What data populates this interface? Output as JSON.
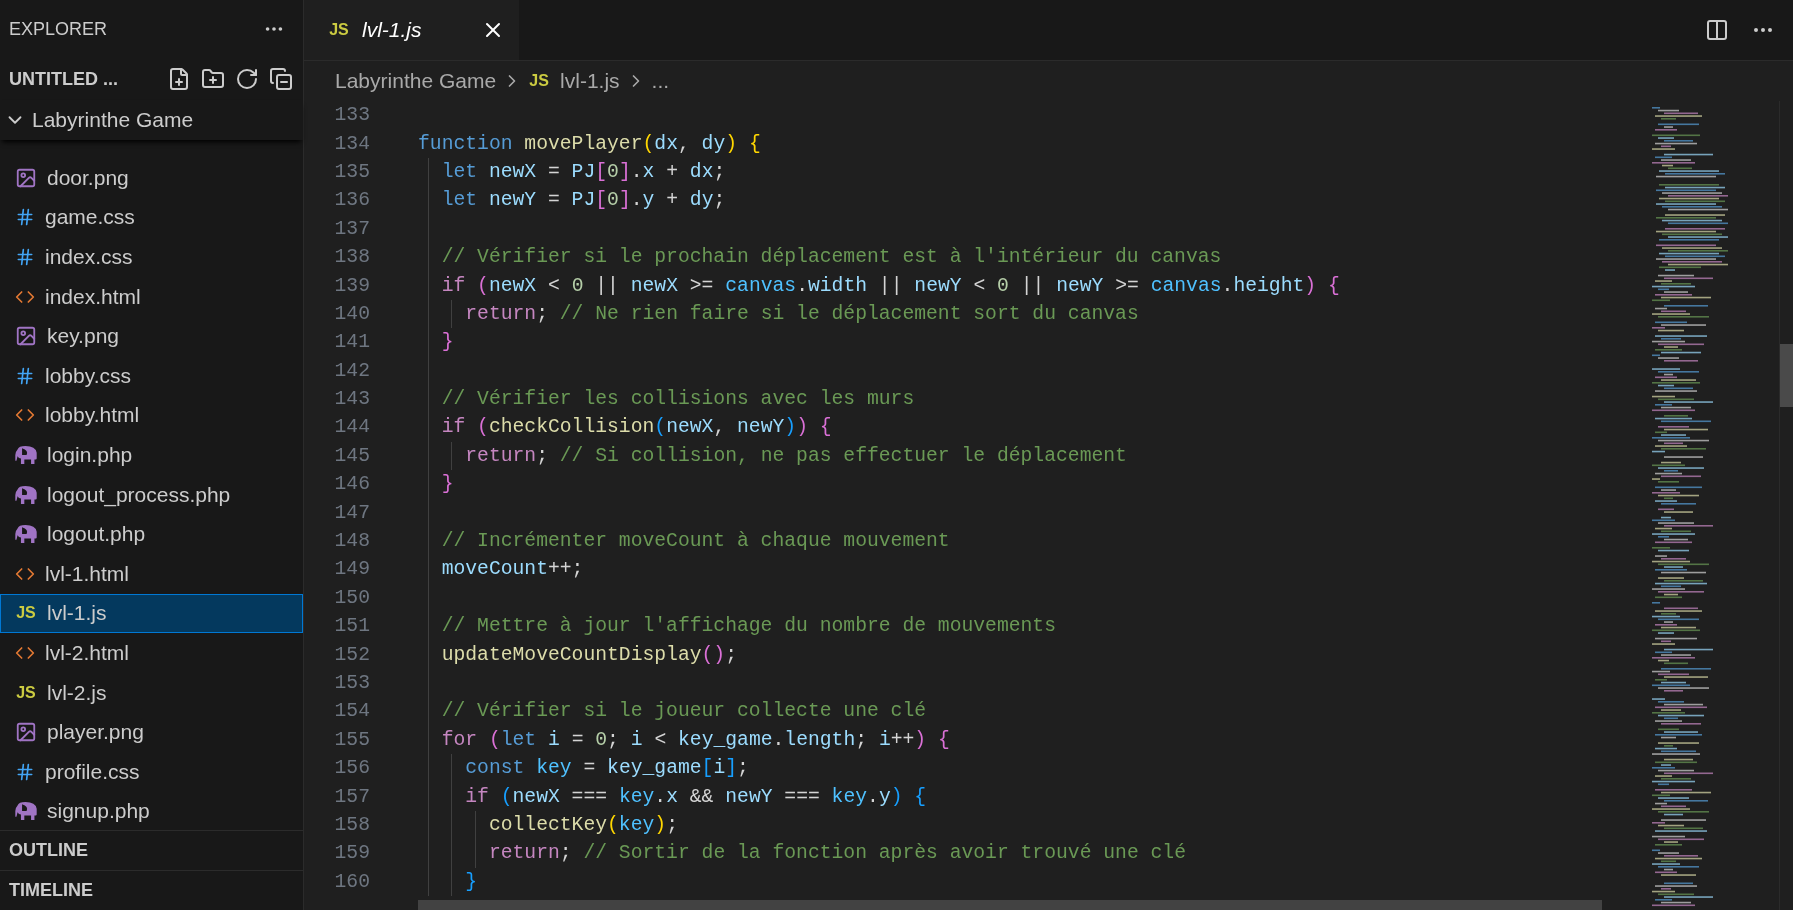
{
  "sidebar": {
    "title": "EXPLORER",
    "workspace": "UNTITLED ...",
    "folder": {
      "name": "Labyrinthe Game",
      "expanded": true,
      "files": [
        {
          "name": "door.png",
          "kind": "image",
          "selected": false
        },
        {
          "name": "game.css",
          "kind": "css",
          "selected": false
        },
        {
          "name": "index.css",
          "kind": "css",
          "selected": false
        },
        {
          "name": "index.html",
          "kind": "html",
          "selected": false
        },
        {
          "name": "key.png",
          "kind": "image",
          "selected": false
        },
        {
          "name": "lobby.css",
          "kind": "css",
          "selected": false
        },
        {
          "name": "lobby.html",
          "kind": "html",
          "selected": false
        },
        {
          "name": "login.php",
          "kind": "php",
          "selected": false
        },
        {
          "name": "logout_process.php",
          "kind": "php",
          "selected": false
        },
        {
          "name": "logout.php",
          "kind": "php",
          "selected": false
        },
        {
          "name": "lvl-1.html",
          "kind": "html",
          "selected": false
        },
        {
          "name": "lvl-1.js",
          "kind": "js",
          "icon_text": "JS",
          "selected": true
        },
        {
          "name": "lvl-2.html",
          "kind": "html",
          "selected": false
        },
        {
          "name": "lvl-2.js",
          "kind": "js",
          "icon_text": "JS",
          "selected": false
        },
        {
          "name": "player.png",
          "kind": "image",
          "selected": false
        },
        {
          "name": "profile.css",
          "kind": "css",
          "selected": false
        },
        {
          "name": "signup.php",
          "kind": "php",
          "selected": false
        }
      ]
    },
    "sections": [
      {
        "title": "OUTLINE"
      },
      {
        "title": "TIMELINE"
      }
    ]
  },
  "tabs": [
    {
      "label": "lvl-1.js",
      "icon_text": "JS",
      "selected": true
    }
  ],
  "breadcrumb": [
    {
      "label": "Labyrinthe Game"
    },
    {
      "label": "lvl-1.js",
      "icon_text": "JS"
    },
    {
      "label": "..."
    }
  ],
  "editor": {
    "lines": [
      {
        "number": "133"
      },
      {
        "number": "134",
        "tokens": [
          {
            "kind": "kw",
            "text": "function "
          },
          {
            "kind": "fn",
            "text": "movePlayer"
          },
          {
            "kind": "b1",
            "text": "("
          },
          {
            "kind": "var",
            "text": "dx"
          },
          {
            "kind": "p",
            "text": ", "
          },
          {
            "kind": "var",
            "text": "dy"
          },
          {
            "kind": "b1",
            "text": ")"
          },
          {
            "kind": "b1",
            "text": " {"
          }
        ]
      },
      {
        "number": "135",
        "tokens": [
          {
            "kind": "kw",
            "text": "  let "
          },
          {
            "kind": "var",
            "text": "newX"
          },
          {
            "kind": "p",
            "text": " = "
          },
          {
            "kind": "var",
            "text": "PJ"
          },
          {
            "kind": "b2",
            "text": "["
          },
          {
            "kind": "num",
            "text": "0"
          },
          {
            "kind": "b2",
            "text": "]"
          },
          {
            "kind": "p",
            "text": "."
          },
          {
            "kind": "var",
            "text": "x"
          },
          {
            "kind": "p",
            "text": " + "
          },
          {
            "kind": "var",
            "text": "dx"
          },
          {
            "kind": "p",
            "text": ";"
          }
        ]
      },
      {
        "number": "136",
        "tokens": [
          {
            "kind": "kw",
            "text": "  let "
          },
          {
            "kind": "var",
            "text": "newY"
          },
          {
            "kind": "p",
            "text": " = "
          },
          {
            "kind": "var",
            "text": "PJ"
          },
          {
            "kind": "b2",
            "text": "["
          },
          {
            "kind": "num",
            "text": "0"
          },
          {
            "kind": "b2",
            "text": "]"
          },
          {
            "kind": "p",
            "text": "."
          },
          {
            "kind": "var",
            "text": "y"
          },
          {
            "kind": "p",
            "text": " + "
          },
          {
            "kind": "var",
            "text": "dy"
          },
          {
            "kind": "p",
            "text": ";"
          }
        ]
      },
      {
        "number": "137"
      },
      {
        "number": "138",
        "tokens": [
          {
            "kind": "cm",
            "text": "  // Vérifier si le prochain déplacement est à l'intérieur du canvas"
          }
        ]
      },
      {
        "number": "139",
        "tokens": [
          {
            "kind": "ctl",
            "text": "  if "
          },
          {
            "kind": "b2",
            "text": "("
          },
          {
            "kind": "var",
            "text": "newX"
          },
          {
            "kind": "p",
            "text": " < "
          },
          {
            "kind": "num",
            "text": "0"
          },
          {
            "kind": "p",
            "text": " || "
          },
          {
            "kind": "var",
            "text": "newX"
          },
          {
            "kind": "p",
            "text": " >= "
          },
          {
            "kind": "const",
            "text": "canvas"
          },
          {
            "kind": "p",
            "text": "."
          },
          {
            "kind": "var",
            "text": "width"
          },
          {
            "kind": "p",
            "text": " || "
          },
          {
            "kind": "var",
            "text": "newY"
          },
          {
            "kind": "p",
            "text": " < "
          },
          {
            "kind": "num",
            "text": "0"
          },
          {
            "kind": "p",
            "text": " || "
          },
          {
            "kind": "var",
            "text": "newY"
          },
          {
            "kind": "p",
            "text": " >= "
          },
          {
            "kind": "const",
            "text": "canvas"
          },
          {
            "kind": "p",
            "text": "."
          },
          {
            "kind": "var",
            "text": "height"
          },
          {
            "kind": "b2",
            "text": ")"
          },
          {
            "kind": "b2",
            "text": " {"
          }
        ]
      },
      {
        "number": "140",
        "tokens": [
          {
            "kind": "ctl",
            "text": "    return"
          },
          {
            "kind": "p",
            "text": "; "
          },
          {
            "kind": "cm",
            "text": "// Ne rien faire si le déplacement sort du canvas"
          }
        ]
      },
      {
        "number": "141",
        "tokens": [
          {
            "kind": "b2",
            "text": "  }"
          }
        ]
      },
      {
        "number": "142"
      },
      {
        "number": "143",
        "tokens": [
          {
            "kind": "cm",
            "text": "  // Vérifier les collisions avec les murs"
          }
        ]
      },
      {
        "number": "144",
        "tokens": [
          {
            "kind": "ctl",
            "text": "  if "
          },
          {
            "kind": "b2",
            "text": "("
          },
          {
            "kind": "fn",
            "text": "checkCollision"
          },
          {
            "kind": "b3",
            "text": "("
          },
          {
            "kind": "var",
            "text": "newX"
          },
          {
            "kind": "p",
            "text": ", "
          },
          {
            "kind": "var",
            "text": "newY"
          },
          {
            "kind": "b3",
            "text": ")"
          },
          {
            "kind": "b2",
            "text": ")"
          },
          {
            "kind": "b2",
            "text": " {"
          }
        ]
      },
      {
        "number": "145",
        "tokens": [
          {
            "kind": "ctl",
            "text": "    return"
          },
          {
            "kind": "p",
            "text": "; "
          },
          {
            "kind": "cm",
            "text": "// Si collision, ne pas effectuer le déplacement"
          }
        ]
      },
      {
        "number": "146",
        "tokens": [
          {
            "kind": "b2",
            "text": "  }"
          }
        ]
      },
      {
        "number": "147"
      },
      {
        "number": "148",
        "tokens": [
          {
            "kind": "cm",
            "text": "  // Incrémenter moveCount à chaque mouvement"
          }
        ]
      },
      {
        "number": "149",
        "tokens": [
          {
            "kind": "var",
            "text": "  moveCount"
          },
          {
            "kind": "p",
            "text": "++;"
          }
        ]
      },
      {
        "number": "150"
      },
      {
        "number": "151",
        "tokens": [
          {
            "kind": "cm",
            "text": "  // Mettre à jour l'affichage du nombre de mouvements"
          }
        ]
      },
      {
        "number": "152",
        "tokens": [
          {
            "kind": "fn",
            "text": "  updateMoveCountDisplay"
          },
          {
            "kind": "b2",
            "text": "()"
          },
          {
            "kind": "p",
            "text": ";"
          }
        ]
      },
      {
        "number": "153"
      },
      {
        "number": "154",
        "tokens": [
          {
            "kind": "cm",
            "text": "  // Vérifier si le joueur collecte une clé"
          }
        ]
      },
      {
        "number": "155",
        "tokens": [
          {
            "kind": "ctl",
            "text": "  for "
          },
          {
            "kind": "b2",
            "text": "("
          },
          {
            "kind": "kw",
            "text": "let "
          },
          {
            "kind": "var",
            "text": "i"
          },
          {
            "kind": "p",
            "text": " = "
          },
          {
            "kind": "num",
            "text": "0"
          },
          {
            "kind": "p",
            "text": "; "
          },
          {
            "kind": "var",
            "text": "i"
          },
          {
            "kind": "p",
            "text": " < "
          },
          {
            "kind": "var",
            "text": "key_game"
          },
          {
            "kind": "p",
            "text": "."
          },
          {
            "kind": "var",
            "text": "length"
          },
          {
            "kind": "p",
            "text": "; "
          },
          {
            "kind": "var",
            "text": "i"
          },
          {
            "kind": "p",
            "text": "++"
          },
          {
            "kind": "b2",
            "text": ")"
          },
          {
            "kind": "b2",
            "text": " {"
          }
        ]
      },
      {
        "number": "156",
        "tokens": [
          {
            "kind": "kw",
            "text": "    const "
          },
          {
            "kind": "const",
            "text": "key"
          },
          {
            "kind": "p",
            "text": " = "
          },
          {
            "kind": "var",
            "text": "key_game"
          },
          {
            "kind": "b3",
            "text": "["
          },
          {
            "kind": "var",
            "text": "i"
          },
          {
            "kind": "b3",
            "text": "]"
          },
          {
            "kind": "p",
            "text": ";"
          }
        ]
      },
      {
        "number": "157",
        "tokens": [
          {
            "kind": "ctl",
            "text": "    if "
          },
          {
            "kind": "b3",
            "text": "("
          },
          {
            "kind": "var",
            "text": "newX"
          },
          {
            "kind": "p",
            "text": " === "
          },
          {
            "kind": "const",
            "text": "key"
          },
          {
            "kind": "p",
            "text": "."
          },
          {
            "kind": "var",
            "text": "x"
          },
          {
            "kind": "p",
            "text": " && "
          },
          {
            "kind": "var",
            "text": "newY"
          },
          {
            "kind": "p",
            "text": " === "
          },
          {
            "kind": "const",
            "text": "key"
          },
          {
            "kind": "p",
            "text": "."
          },
          {
            "kind": "var",
            "text": "y"
          },
          {
            "kind": "b3",
            "text": ")"
          },
          {
            "kind": "b3",
            "text": " {"
          }
        ]
      },
      {
        "number": "158",
        "tokens": [
          {
            "kind": "fn",
            "text": "      collectKey"
          },
          {
            "kind": "b1",
            "text": "("
          },
          {
            "kind": "const",
            "text": "key"
          },
          {
            "kind": "b1",
            "text": ")"
          },
          {
            "kind": "p",
            "text": ";"
          }
        ]
      },
      {
        "number": "159",
        "tokens": [
          {
            "kind": "ctl",
            "text": "      return"
          },
          {
            "kind": "p",
            "text": "; "
          },
          {
            "kind": "cm",
            "text": "// Sortir de la fonction après avoir trouvé une clé"
          }
        ]
      },
      {
        "number": "160",
        "tokens": [
          {
            "kind": "b3",
            "text": "    }"
          }
        ]
      }
    ]
  }
}
